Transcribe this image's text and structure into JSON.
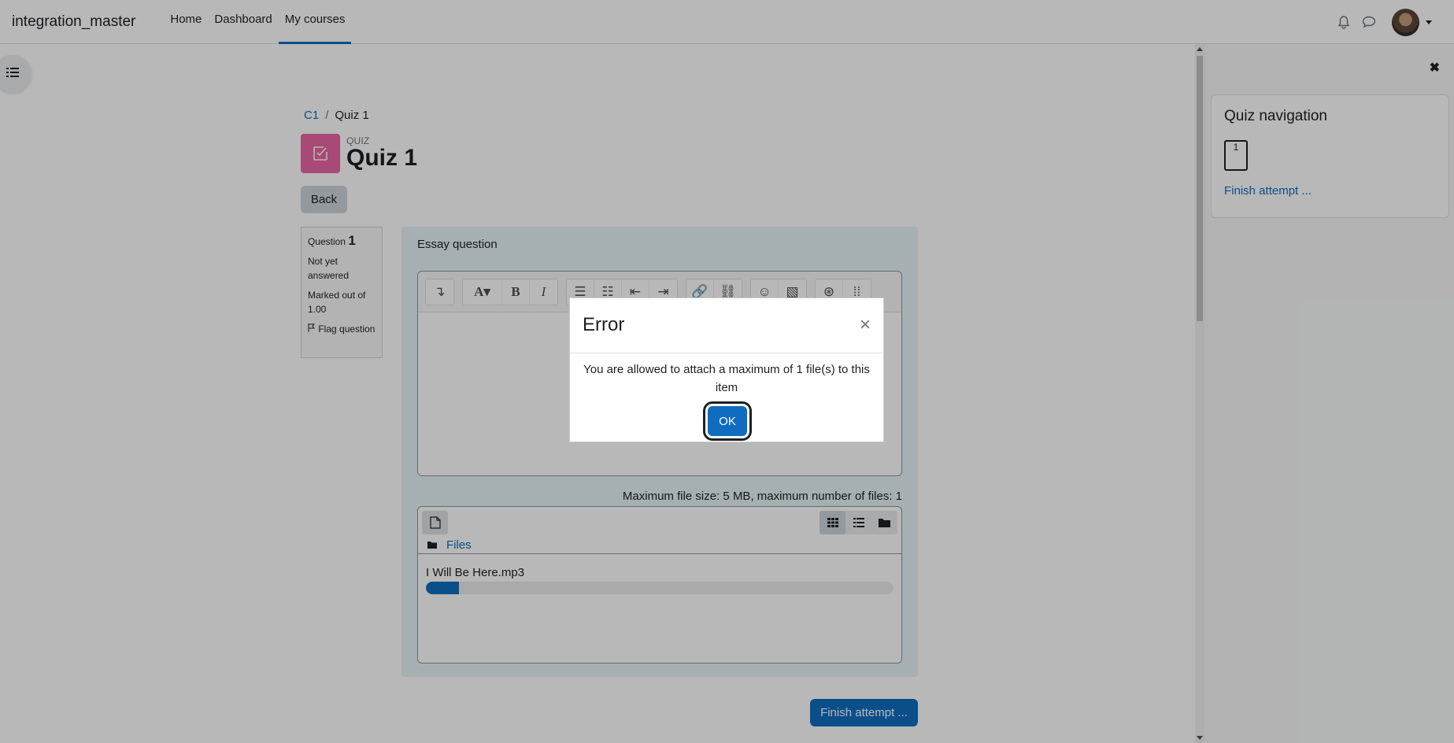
{
  "navbar": {
    "brand": "integration_master",
    "links": [
      {
        "label": "Home",
        "active": false
      },
      {
        "label": "Dashboard",
        "active": false
      },
      {
        "label": "My courses",
        "active": true
      }
    ],
    "icons": [
      "bell-icon",
      "chat-icon"
    ],
    "accent_color": "#0f6cbf"
  },
  "breadcrumb": {
    "course": "C1",
    "current": "Quiz 1"
  },
  "header": {
    "activity_type": "QUIZ",
    "title": "Quiz 1",
    "activity_color": "#eb66a2"
  },
  "back_label": "Back",
  "question_info": {
    "label": "Question",
    "number": "1",
    "state": "Not yet answered",
    "marks": "Marked out of 1.00",
    "flag_label": "Flag question"
  },
  "question": {
    "text": "Essay question",
    "file_limits": "Maximum file size: 5 MB, maximum number of files: 1",
    "files_folder": "Files",
    "uploading_file": "I Will Be Here.mp3",
    "upload_progress_percent": 7
  },
  "finish_label": "Finish attempt ...",
  "quiz_navigation": {
    "title": "Quiz navigation",
    "question_buttons": [
      "1"
    ],
    "finish_link": "Finish attempt ..."
  },
  "modal": {
    "title": "Error",
    "message": "You are allowed to attach a maximum of 1 file(s) to this item",
    "ok_label": "OK",
    "close_symbol": "×"
  }
}
